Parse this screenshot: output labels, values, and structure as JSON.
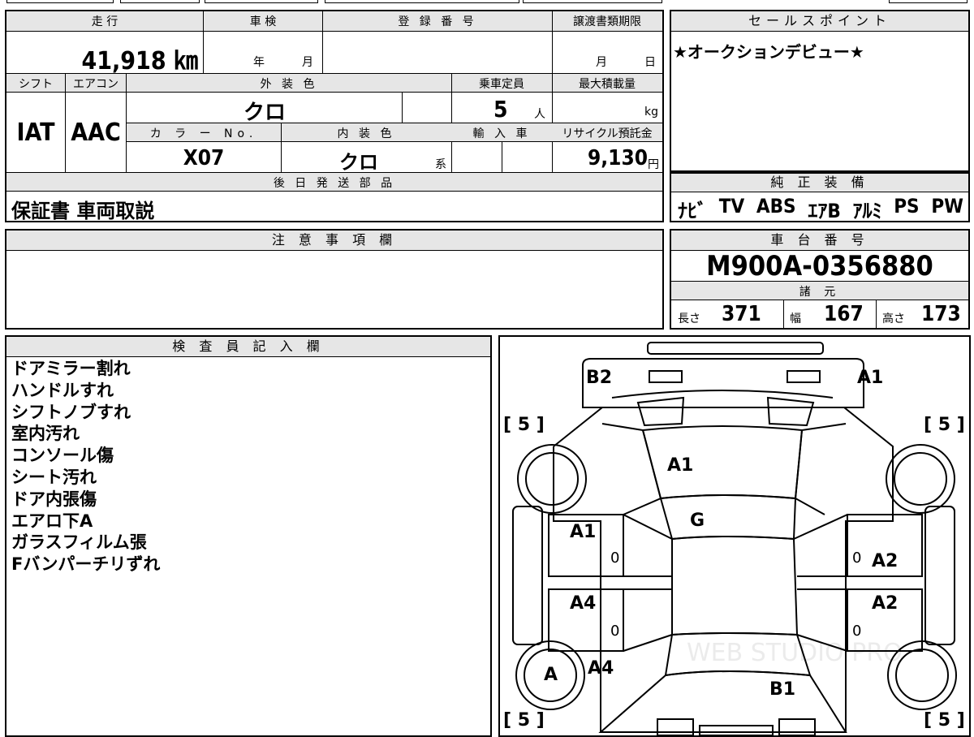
{
  "vehicle": {
    "mileage_header": "走 行",
    "mileage": "41,918 ㎞",
    "shaken_header": "車 検",
    "shaken_year_unit": "年",
    "shaken_month_unit": "月",
    "registration_header": "登 録 番 号",
    "transfer_header": "譲渡書類期限",
    "transfer_month_unit": "月",
    "transfer_day_unit": "日",
    "shift_header": "シフト",
    "shift": "IAT",
    "aircon_header": "エアコン",
    "aircon": "AAC",
    "ext_color_header": "外 装 色",
    "ext_color": "クロ",
    "capacity_header": "乗車定員",
    "capacity": "5",
    "capacity_unit": "人",
    "max_load_header": "最大積載量",
    "max_load_unit": "kg",
    "color_no_header": "カ ラ ー No.",
    "color_no": "X07",
    "int_color_header": "内 装 色",
    "int_color": "クロ",
    "int_color_unit": "系",
    "import_header": "輸 入 車",
    "recycle_header": "リサイクル預託金",
    "recycle_fee": "9,130",
    "recycle_unit": "円",
    "parts_header": "後 日 発 送 部 品",
    "parts": "保証書 車両取説"
  },
  "sales_point": {
    "header": "セールスポイント",
    "text": "★オークションデビュー★"
  },
  "equipment": {
    "header": "純 正 装 備",
    "items": [
      "ﾅﾋﾞ",
      "TV",
      "ABS",
      "ｴｱB",
      "ｱﾙﾐ",
      "PS",
      "PW"
    ]
  },
  "notes": {
    "header": "注 意 事 項 欄"
  },
  "chassis": {
    "header": "車 台 番 号",
    "number": "M900A-0356880",
    "specs_header": "諸 元",
    "length_label": "長さ",
    "length": "371",
    "width_label": "幅",
    "width": "167",
    "height_label": "高さ",
    "height": "173"
  },
  "inspector": {
    "header": "検 査 員 記 入 欄",
    "lines": [
      "ドアミラー割れ",
      "ハンドルすれ",
      "シフトノブすれ",
      "室内汚れ",
      "コンソール傷",
      "シート汚れ",
      "ドア内張傷",
      "エアロ下A",
      "ガラスフィルム張",
      "Fバンパーチリずれ"
    ]
  },
  "diagram": {
    "marks": {
      "b2": "B2",
      "a1_front_right": "A1",
      "a1_hood": "A1",
      "g_windshield": "G",
      "a1_left_front_door": "A1",
      "a2_right_front_door": "A2",
      "a4_left_rear_door": "A4",
      "a2_right_rear_door": "A2",
      "a_left_rear_wheel": "A",
      "a4_left_rear_fender": "A4",
      "b1_rear": "B1"
    },
    "tires": {
      "front_left": "5",
      "front_right": "5",
      "rear_left": "5",
      "rear_right": "5"
    },
    "door_zeros": [
      "0",
      "0",
      "0",
      "0"
    ],
    "watermark": "WEB STUDIO PRO"
  }
}
